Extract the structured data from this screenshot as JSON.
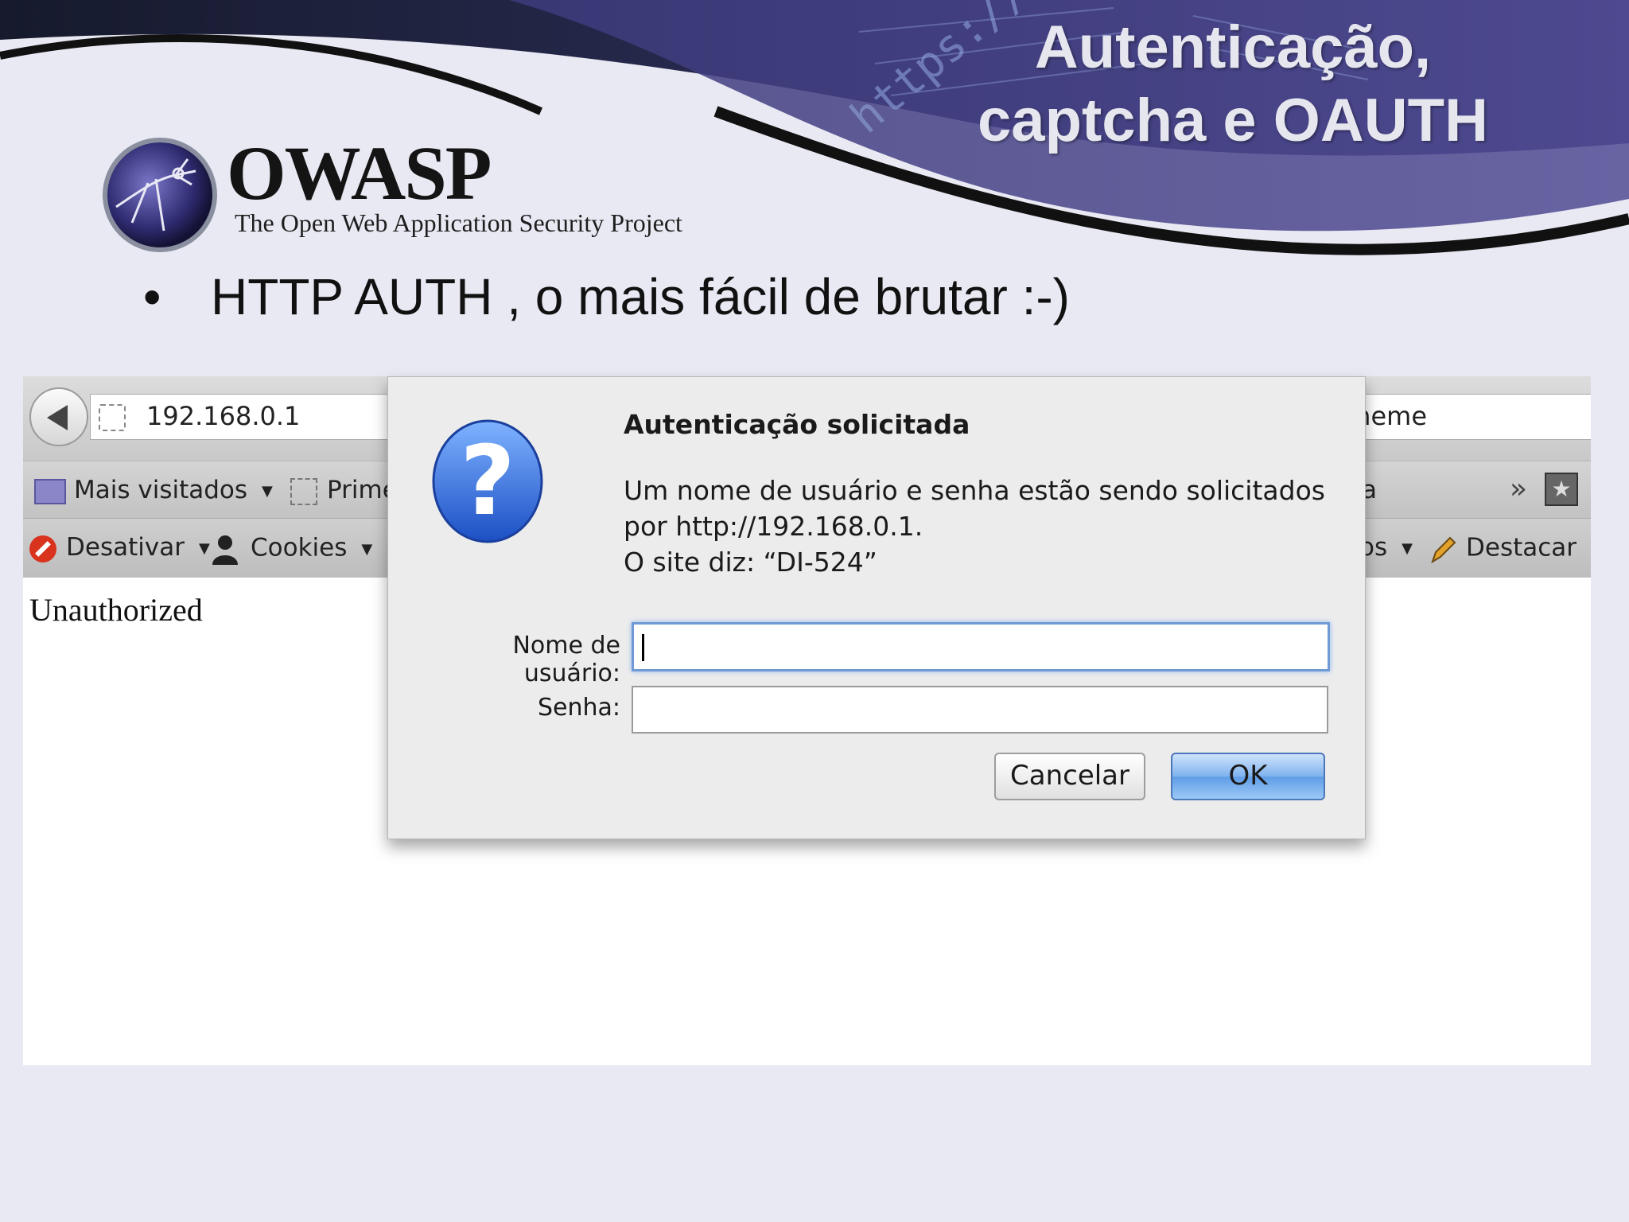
{
  "slide": {
    "title_line1": "Autenticação,",
    "title_line2": "captcha e OAUTH",
    "logo_name": "OWASP",
    "logo_subtitle": "The Open Web Application Security Project",
    "bullet": "HTTP AUTH , o mais fácil de brutar :-)",
    "banner_watermark": "https://"
  },
  "browser": {
    "url": "192.168.0.1",
    "url_right_partial": "neme",
    "bookmarks": [
      {
        "label": "Mais visitados",
        "icon": "folder-icon"
      },
      {
        "label": "Prime",
        "icon": "dashed-page-icon"
      },
      {
        "label": "a",
        "icon": ""
      }
    ],
    "toolbar_items": [
      {
        "label": "Desativar",
        "icon": "disable-icon"
      },
      {
        "label": "Cookies",
        "icon": "person-icon"
      },
      {
        "label": "os",
        "icon": ""
      },
      {
        "label": "Destacar",
        "icon": "pencil-icon"
      }
    ],
    "overflow_glyph": "»",
    "page_text": "Unauthorized"
  },
  "dialog": {
    "title": "Autenticação solicitada",
    "message_line1": "Um nome de usuário e senha estão sendo solicitados",
    "message_line2": "por http://192.168.0.1.",
    "message_line3": "O site diz: “DI-524”",
    "username_label": "Nome de usuário:",
    "username_value": "",
    "password_label": "Senha:",
    "password_value": "",
    "cancel_label": "Cancelar",
    "ok_label": "OK",
    "icon": "question-icon"
  },
  "colors": {
    "banner_dark": "#1c1c2e",
    "banner_purple": "#4b4689",
    "slide_bg": "#e9e9f3",
    "ok_button": "#6fa6ea"
  }
}
